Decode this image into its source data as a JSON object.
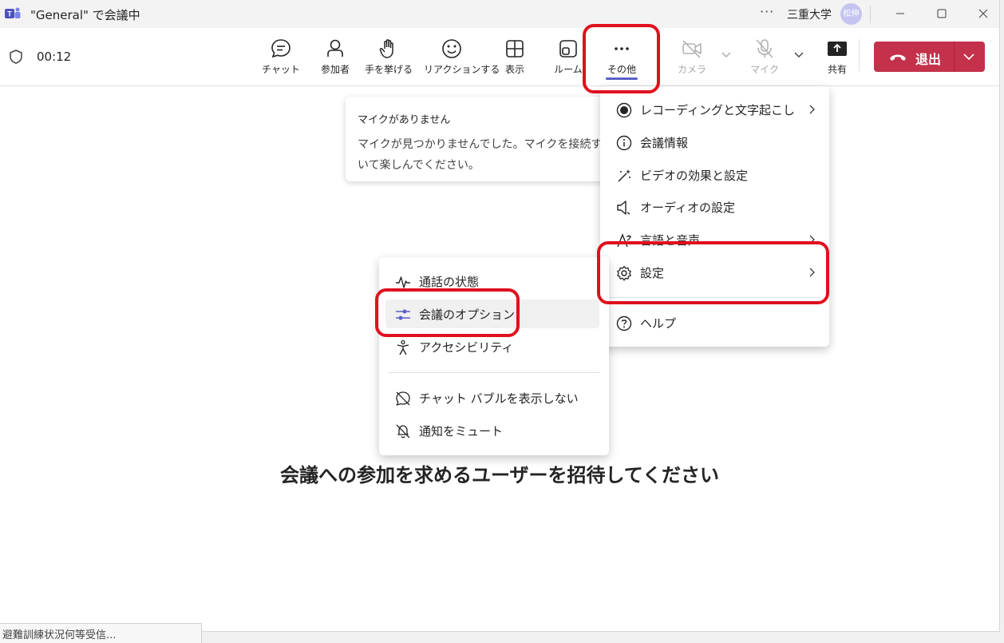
{
  "window": {
    "title": "\"General\" で会議中",
    "more": "···",
    "org": "三重大学",
    "avatar": "松伸"
  },
  "toolbar": {
    "timer": "00:12",
    "buttons": [
      {
        "label": "チャット",
        "icon": "chat-icon"
      },
      {
        "label": "参加者",
        "icon": "people-icon"
      },
      {
        "label": "手を挙げる",
        "icon": "hand-icon"
      },
      {
        "label": "リアクションする",
        "icon": "smile-icon"
      },
      {
        "label": "表示",
        "icon": "grid-icon"
      },
      {
        "label": "ルーム",
        "icon": "room-icon"
      },
      {
        "label": "その他",
        "icon": "more-icon"
      },
      {
        "label": "カメラ",
        "icon": "camera-off-icon"
      },
      {
        "label": "マイク",
        "icon": "mic-off-icon"
      },
      {
        "label": "共有",
        "icon": "share-icon"
      }
    ],
    "leave": "退出"
  },
  "toast": {
    "title": "マイクがありません",
    "line1": "マイクが見つかりませんでした。マイクを接続する",
    "line2": "いて楽しんでください。"
  },
  "more_menu": {
    "items": [
      {
        "label": "レコーディングと文字起こし",
        "icon": "record-icon",
        "submenu": true
      },
      {
        "label": "会議情報",
        "icon": "info-icon",
        "submenu": false
      },
      {
        "label": "ビデオの効果と設定",
        "icon": "magic-wand-icon",
        "submenu": false
      },
      {
        "label": "オーディオの設定",
        "icon": "speaker-icon",
        "submenu": false
      },
      {
        "label": "言語と音声",
        "icon": "language-icon",
        "submenu": true
      },
      {
        "label": "設定",
        "icon": "gear-icon",
        "submenu": true
      },
      {
        "label": "ヘルプ",
        "icon": "help-icon",
        "submenu": false
      }
    ]
  },
  "settings_submenu": {
    "items": [
      {
        "label": "通話の状態",
        "icon": "pulse-icon"
      },
      {
        "label": "会議のオプション",
        "icon": "sliders-icon"
      },
      {
        "label": "アクセシビリティ",
        "icon": "accessibility-icon"
      },
      {
        "label": "チャット バブルを表示しない",
        "icon": "chat-off-icon"
      },
      {
        "label": "通知をミュート",
        "icon": "bell-off-icon"
      }
    ]
  },
  "stage": {
    "invite_text": "会議への参加を求めるユーザーを招待してください"
  },
  "taskbar": {
    "snippet": "避難訓練状況何等受信..."
  },
  "colors": {
    "accent": "#5b5fc7",
    "leave": "#c4314b",
    "annotation": "#e0101e"
  }
}
